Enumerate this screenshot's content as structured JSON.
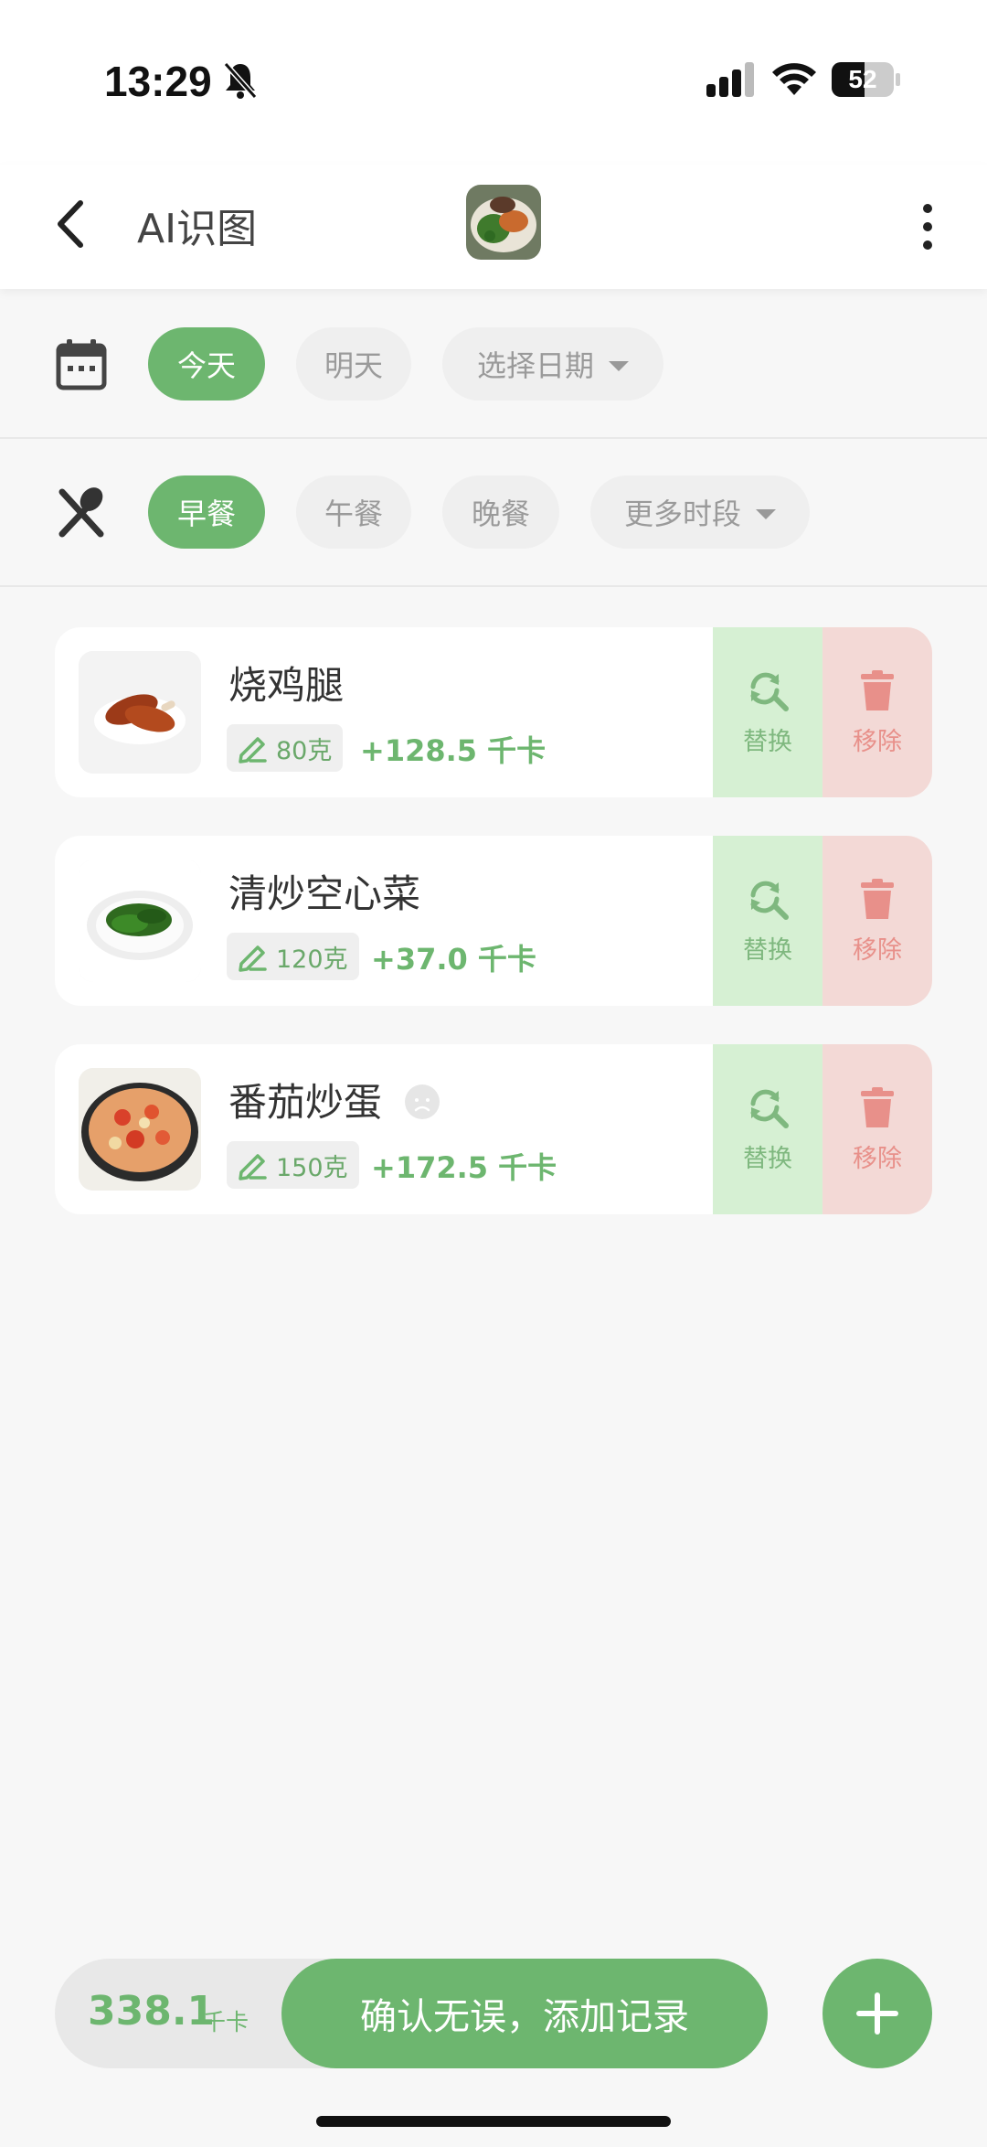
{
  "status_bar": {
    "time": "13:29",
    "battery": "52"
  },
  "header": {
    "title": "AI识图"
  },
  "date_filter": {
    "chips": [
      {
        "label": "今天",
        "active": true
      },
      {
        "label": "明天",
        "active": false
      },
      {
        "label": "选择日期",
        "active": false
      }
    ]
  },
  "meal_filter": {
    "chips": [
      {
        "label": "早餐",
        "active": true
      },
      {
        "label": "午餐",
        "active": false
      },
      {
        "label": "晚餐",
        "active": false
      },
      {
        "label": "更多时段",
        "active": false
      }
    ]
  },
  "foods": [
    {
      "name": "烧鸡腿",
      "weight": "80克",
      "kcal": "+128.5 千卡"
    },
    {
      "name": "清炒空心菜",
      "weight": "120克",
      "kcal": "+37.0 千卡"
    },
    {
      "name": "番茄炒蛋",
      "weight": "150克",
      "kcal": "+172.5 千卡"
    }
  ],
  "actions": {
    "replace": "替换",
    "remove": "移除"
  },
  "bottom": {
    "total": "338.1",
    "unit": "千卡",
    "confirm": "确认无误，添加记录"
  },
  "colors": {
    "accent": "#6db66f",
    "replace_bg": "#d6f0d3",
    "remove_bg": "#f3d9d6"
  }
}
